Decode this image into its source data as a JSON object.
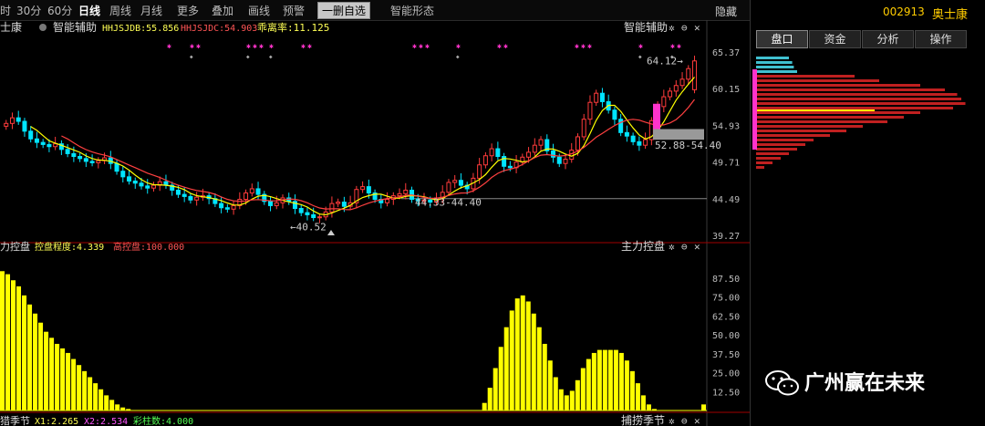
{
  "toolbar": {
    "items": [
      "时",
      "30分",
      "60分",
      "日线",
      "周线",
      "月线",
      "更多",
      "叠加",
      "画线",
      "预警",
      "一删自选",
      "智能形态"
    ],
    "active": "日线",
    "hide_label": "隐藏"
  },
  "stock": {
    "code": "002913",
    "name": "奥士康"
  },
  "right_tabs": [
    "盘口",
    "资金",
    "分析",
    "操作"
  ],
  "main_panel": {
    "name_label": "士康",
    "indicator_label": "智能辅助",
    "hhjsjdb": "HHJSJDB:55.856",
    "hhjsjdc": "HHJSJDC:54.903",
    "deviation": "乖离率:11.125",
    "settings_label": "智能辅助",
    "y_ticks": [
      "65.37",
      "60.15",
      "54.93",
      "49.71",
      "44.49",
      "39.27"
    ],
    "annotations": {
      "high": "64.12",
      "low": "40.52",
      "range1": "52.88-54.40",
      "range2": "44.33-44.40"
    }
  },
  "sub_panel": {
    "title": "力控盘",
    "degree": "控盘程度:4.339",
    "high_control": "高控盘:100.000",
    "settings_label": "主力控盘",
    "y_ticks": [
      "87.50",
      "75.00",
      "62.50",
      "50.00",
      "37.50",
      "25.00",
      "12.50"
    ]
  },
  "bottom_panel": {
    "title": "猎季节",
    "x1": "X1:2.265",
    "x2": "X2:2.534",
    "color_count": "彩柱数:4.000",
    "settings_label": "捕捞季节"
  },
  "watermark": "广州赢在未来",
  "colors": {
    "up": "#ff3b3b",
    "down": "#00e5ff",
    "ma5": "#ffff00",
    "ma10": "#ff4040",
    "bars": "#ffff00",
    "magenta": "#ff33cc"
  },
  "chart_data": {
    "type": "candlestick",
    "ylim": [
      39.27,
      65.37
    ],
    "close": [
      55.2,
      56.0,
      55.5,
      54.1,
      53.0,
      52.5,
      52.2,
      51.9,
      52.3,
      51.5,
      50.9,
      50.5,
      50.2,
      49.8,
      49.6,
      49.9,
      50.3,
      49.5,
      48.4,
      47.6,
      47.0,
      46.7,
      46.3,
      46.0,
      46.4,
      46.9,
      46.4,
      45.7,
      45.1,
      44.8,
      44.3,
      44.7,
      44.9,
      44.5,
      43.8,
      43.2,
      43.0,
      43.5,
      44.4,
      45.3,
      45.9,
      45.1,
      44.1,
      43.5,
      43.9,
      44.6,
      44.1,
      43.1,
      42.5,
      42.2,
      41.8,
      41.9,
      42.6,
      43.8,
      44.0,
      43.4,
      43.9,
      45.8,
      46.2,
      45.3,
      44.4,
      43.9,
      44.4,
      44.9,
      45.2,
      45.7,
      44.4,
      44.2,
      44.3,
      44.0,
      44.6,
      45.4,
      46.8,
      47.1,
      46.4,
      45.9,
      47.4,
      49.3,
      50.6,
      51.6,
      50.5,
      49.1,
      48.9,
      49.7,
      50.4,
      51.1,
      52.1,
      52.9,
      51.3,
      50.4,
      49.5,
      50.1,
      51.4,
      53.3,
      55.8,
      58.2,
      59.5,
      58.3,
      57.1,
      55.8,
      53.9,
      53.4,
      52.6,
      52.1,
      52.9,
      55.6,
      57.6,
      59.0,
      59.8,
      60.6,
      61.5,
      63.0,
      64.1
    ],
    "open": [
      54.8,
      55.2,
      56.0,
      55.5,
      54.1,
      53.0,
      52.5,
      52.2,
      51.9,
      52.3,
      51.5,
      50.9,
      50.5,
      50.2,
      49.8,
      49.6,
      49.9,
      50.3,
      49.5,
      48.4,
      47.6,
      47.0,
      46.7,
      46.3,
      46.0,
      46.4,
      46.9,
      46.4,
      45.7,
      45.1,
      44.8,
      44.3,
      44.7,
      44.9,
      44.5,
      43.8,
      43.2,
      43.0,
      43.5,
      44.4,
      45.3,
      45.9,
      45.1,
      44.1,
      43.5,
      43.9,
      44.6,
      44.1,
      43.1,
      42.5,
      42.2,
      41.8,
      41.9,
      42.6,
      43.8,
      44.0,
      43.4,
      43.9,
      45.8,
      46.2,
      45.3,
      44.4,
      43.9,
      44.4,
      44.9,
      45.2,
      45.7,
      44.4,
      44.2,
      44.3,
      44.0,
      44.6,
      45.4,
      46.8,
      47.1,
      46.4,
      45.9,
      47.4,
      49.3,
      50.6,
      51.6,
      50.5,
      49.1,
      48.9,
      49.7,
      50.4,
      51.1,
      52.1,
      52.9,
      51.3,
      50.4,
      49.5,
      50.1,
      51.4,
      53.3,
      55.8,
      58.2,
      59.5,
      58.3,
      57.1,
      55.8,
      53.9,
      53.4,
      52.6,
      52.1,
      52.9,
      55.6,
      57.6,
      59.0,
      59.8,
      60.6,
      61.5,
      60.0
    ],
    "control_bars": [
      92,
      90,
      86,
      82,
      76,
      70,
      64,
      58,
      52,
      48,
      44,
      41,
      38,
      34,
      30,
      26,
      22,
      18,
      14,
      10,
      7,
      4,
      2,
      1,
      0,
      0,
      0,
      0,
      0,
      0,
      0,
      0,
      0,
      0,
      0,
      0,
      0,
      0,
      0,
      0,
      0,
      0,
      0,
      0,
      0,
      0,
      0,
      0,
      0,
      0,
      0,
      0,
      0,
      0,
      0,
      0,
      0,
      0,
      0,
      0,
      0,
      0,
      0,
      0,
      0,
      0,
      0,
      0,
      0,
      0,
      0,
      0,
      0,
      0,
      0,
      0,
      0,
      0,
      0,
      0,
      0,
      0,
      0,
      0,
      0,
      0,
      0,
      0,
      5,
      15,
      28,
      42,
      55,
      66,
      74,
      76,
      72,
      64,
      55,
      44,
      33,
      22,
      14,
      10,
      13,
      20,
      28,
      34,
      38,
      40,
      40,
      40,
      40,
      38,
      33,
      26,
      18,
      10,
      4,
      1,
      0,
      0,
      0,
      0,
      0,
      0,
      0,
      0,
      4
    ]
  }
}
